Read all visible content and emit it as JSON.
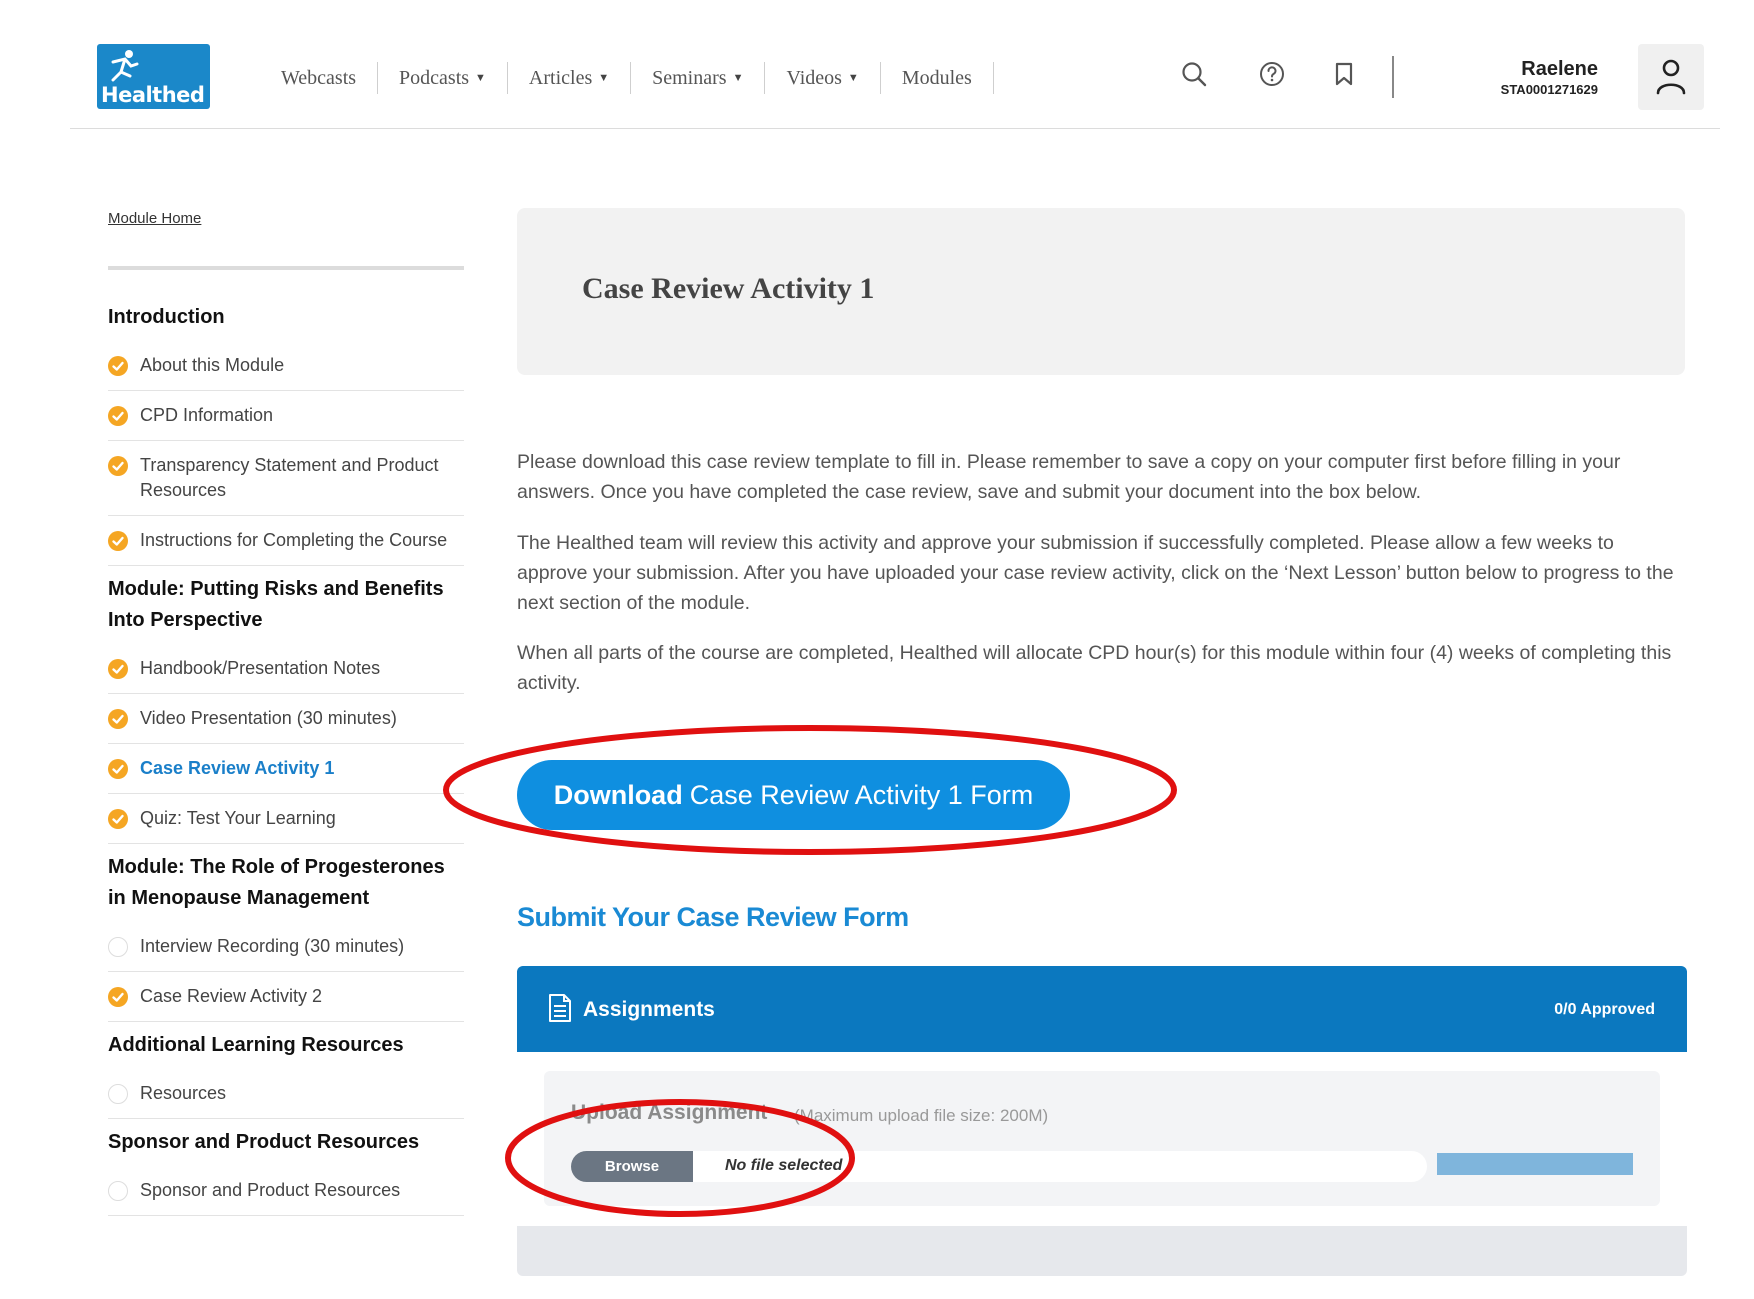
{
  "brand": {
    "logo_text": "Healthed"
  },
  "nav": [
    {
      "label": "Webcasts",
      "has_dropdown": false
    },
    {
      "label": "Podcasts",
      "has_dropdown": true
    },
    {
      "label": "Articles",
      "has_dropdown": true
    },
    {
      "label": "Seminars",
      "has_dropdown": true
    },
    {
      "label": "Videos",
      "has_dropdown": true
    },
    {
      "label": "Modules",
      "has_dropdown": false
    }
  ],
  "header_icons": [
    "search-icon",
    "help-icon",
    "bookmark-icon"
  ],
  "user": {
    "name": "Raelene",
    "id": "STA0001271629",
    "icon": "user-icon"
  },
  "sidebar": {
    "module_home": "Module Home",
    "sections": [
      {
        "title": "Introduction",
        "items": [
          {
            "label": "About this Module",
            "done": true
          },
          {
            "label": "CPD Information",
            "done": true
          },
          {
            "label": "Transparency Statement and Product Resources",
            "done": true
          },
          {
            "label": "Instructions for Completing the Course",
            "done": true
          }
        ]
      },
      {
        "title": "Module: Putting Risks and Benefits Into Perspective",
        "items": [
          {
            "label": "Handbook/Presentation Notes",
            "done": true
          },
          {
            "label": "Video Presentation (30 minutes)",
            "done": true
          },
          {
            "label": "Case Review Activity 1",
            "done": true,
            "active": true
          },
          {
            "label": "Quiz: Test Your Learning",
            "done": true
          }
        ]
      },
      {
        "title": "Module: The Role of Progesterones in Menopause Management",
        "items": [
          {
            "label": "Interview Recording (30 minutes)",
            "done": false
          },
          {
            "label": "Case Review Activity 2",
            "done": true
          }
        ]
      },
      {
        "title": "Additional Learning Resources",
        "items": [
          {
            "label": "Resources",
            "done": false
          }
        ]
      },
      {
        "title": "Sponsor and Product Resources",
        "items": [
          {
            "label": "Sponsor and Product Resources",
            "done": false
          }
        ]
      }
    ]
  },
  "main": {
    "title": "Case Review Activity 1",
    "paragraphs": [
      "Please download this case review template to fill in. Please remember to save a copy on your computer first before filling in your answers. Once you have completed the case review, save and submit your document into the box below.",
      "The Healthed team will review this activity and approve your submission if successfully completed. Please allow a few weeks to approve your submission. After you have uploaded your case review activity, click on the ‘Next Lesson’ button below to progress to the next section of the module.",
      "When all parts of the course are completed, Healthed will allocate CPD hour(s) for this module within four (4) weeks of completing this activity."
    ],
    "download_button": {
      "bold": "Download",
      "rest": "Case Review Activity 1 Form"
    },
    "submit_heading": "Submit Your Case Review Form",
    "assignments": {
      "title": "Assignments",
      "status": "0/0 Approved",
      "upload_label": "Upload Assignment",
      "upload_note": "(Maximum upload file size: 200M)",
      "browse_label": "Browse",
      "file_status": "No file selected"
    }
  },
  "colors": {
    "primary": "#0f8fe0",
    "assign_bar": "#0b78bf",
    "check_orange": "#f5a623",
    "annotation_red": "#e01010"
  }
}
